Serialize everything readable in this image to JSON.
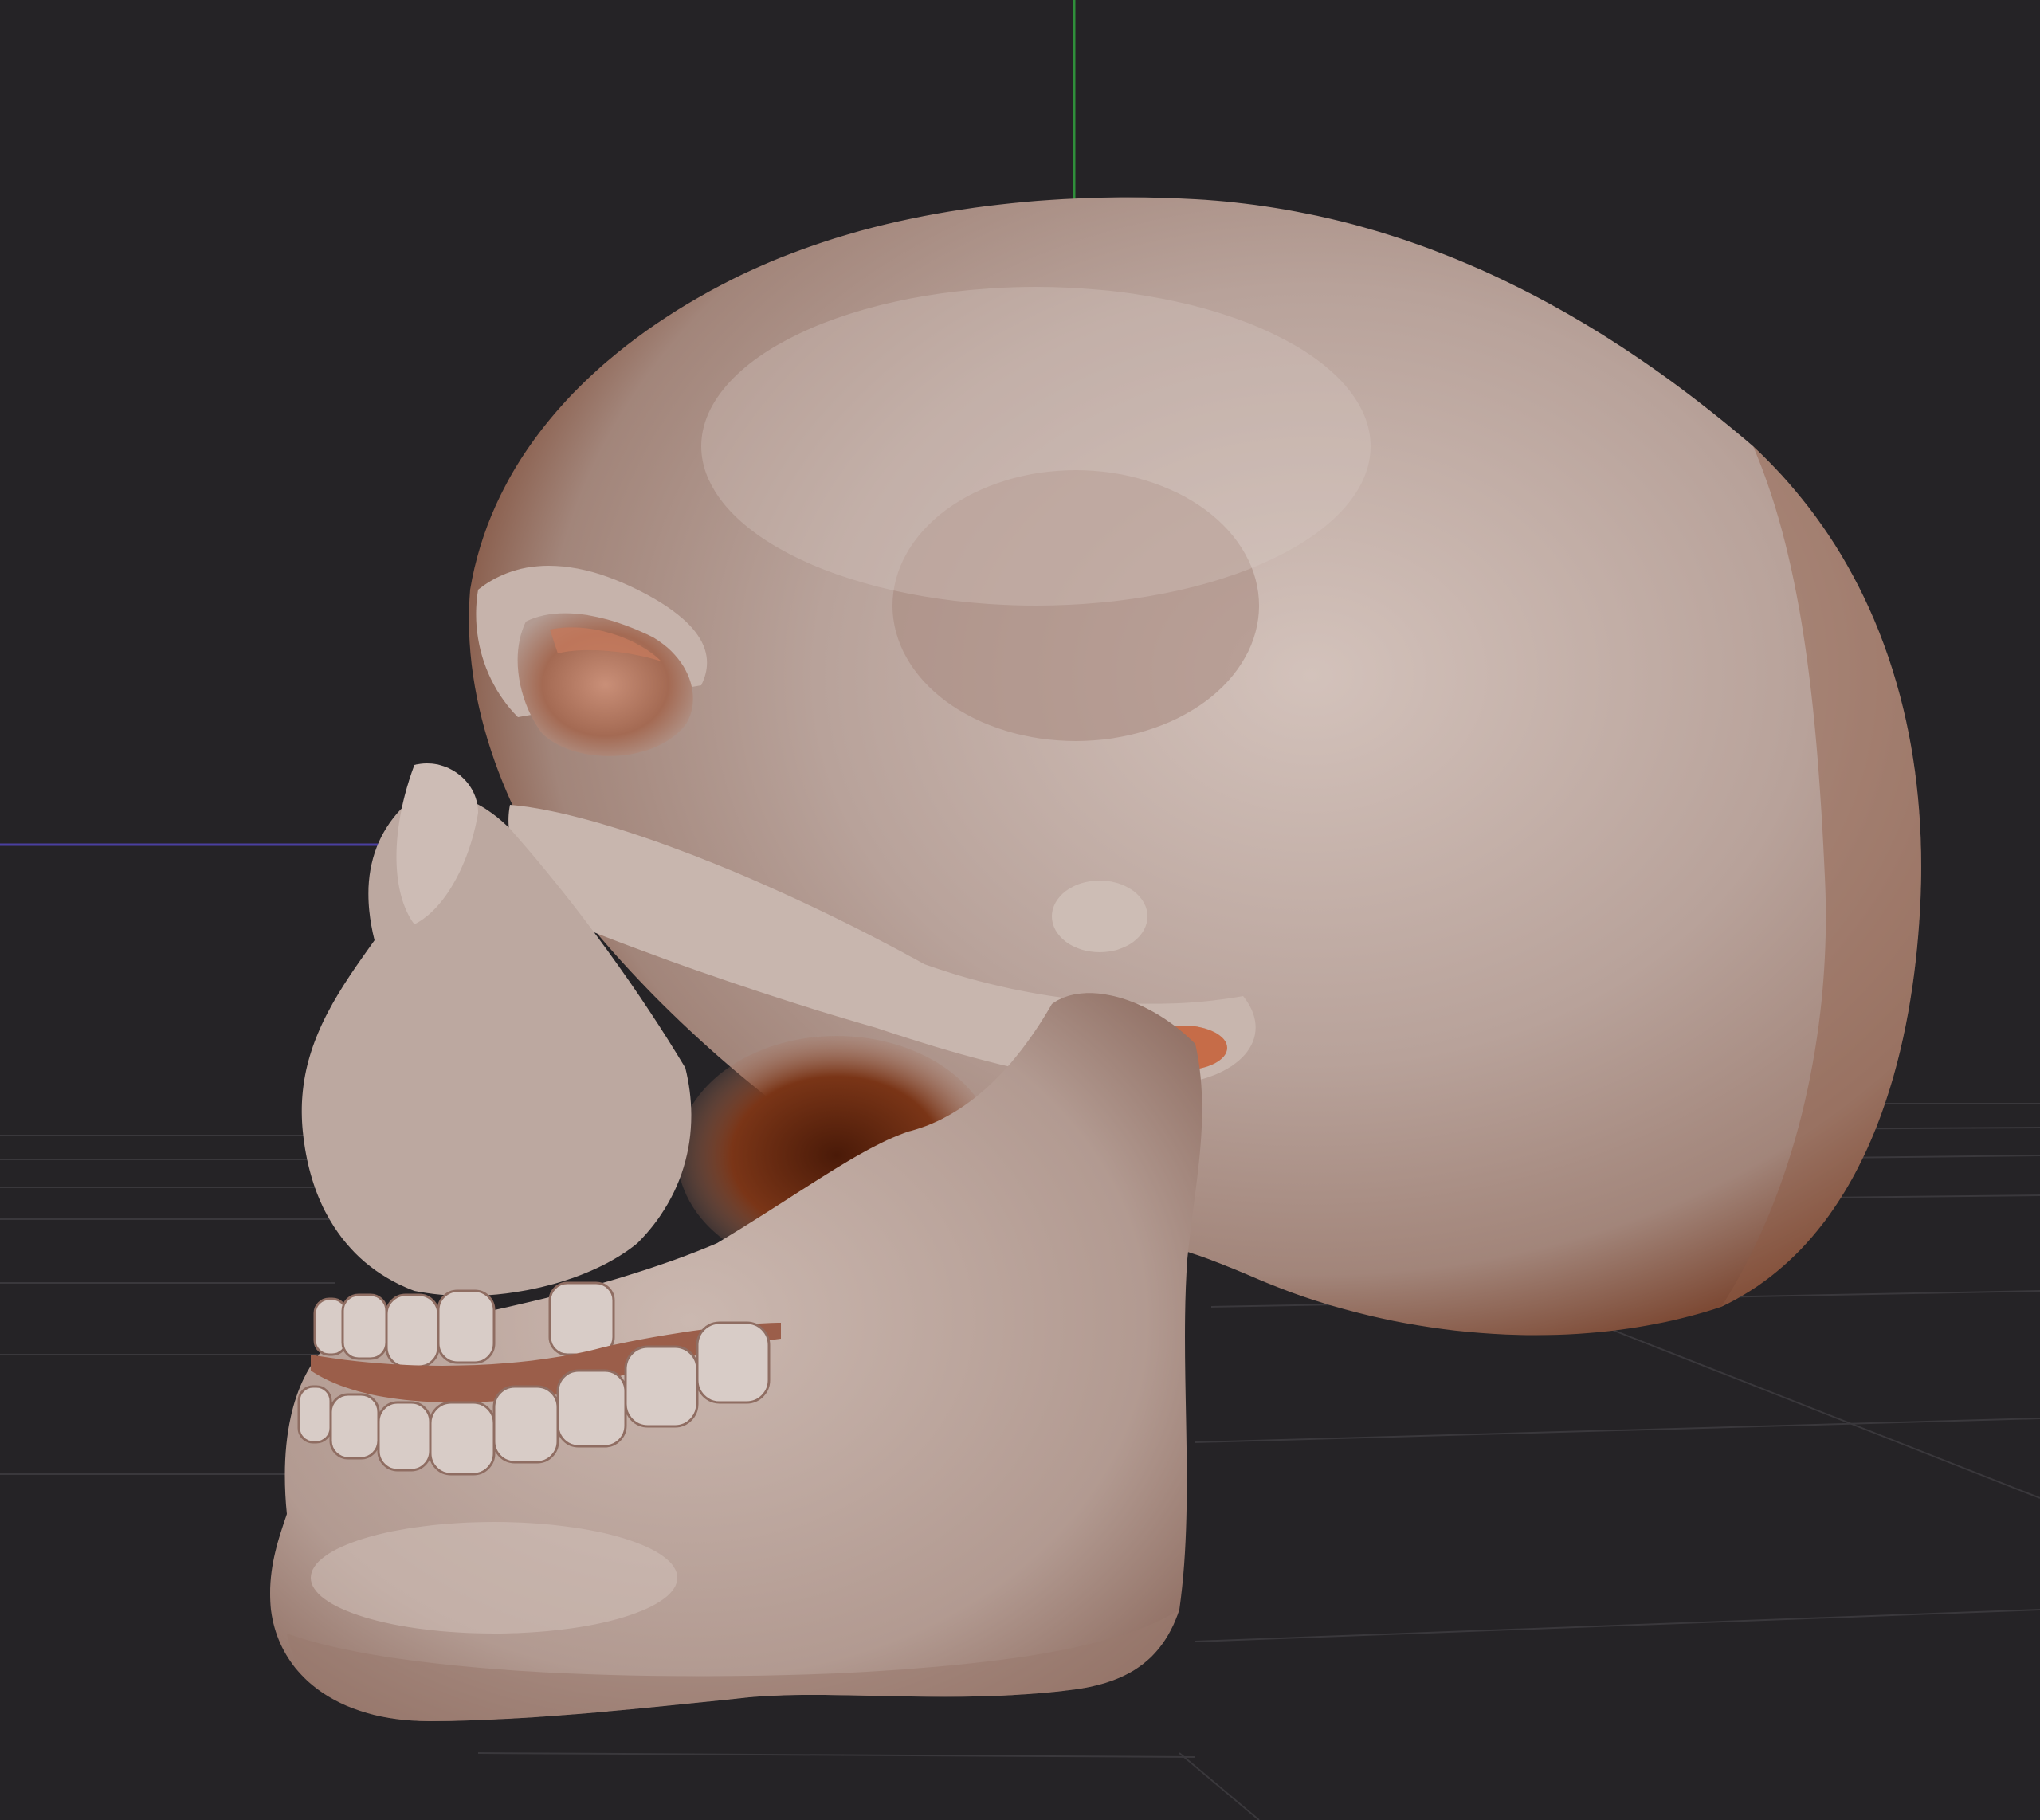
{
  "viewport": {
    "background_color": "#252326",
    "grid_color": "#3a383c",
    "axis_y_color": "#2f8f3a",
    "axis_x_color": "#4a3fa0"
  },
  "model": {
    "name_icon": "skull-model",
    "base_color": "#b9a39b",
    "highlight_color": "#d9c8c1",
    "shadow_color": "#8f5a45",
    "cavity_color": "#6b2a12",
    "teeth_color": "#d8ccc7"
  }
}
